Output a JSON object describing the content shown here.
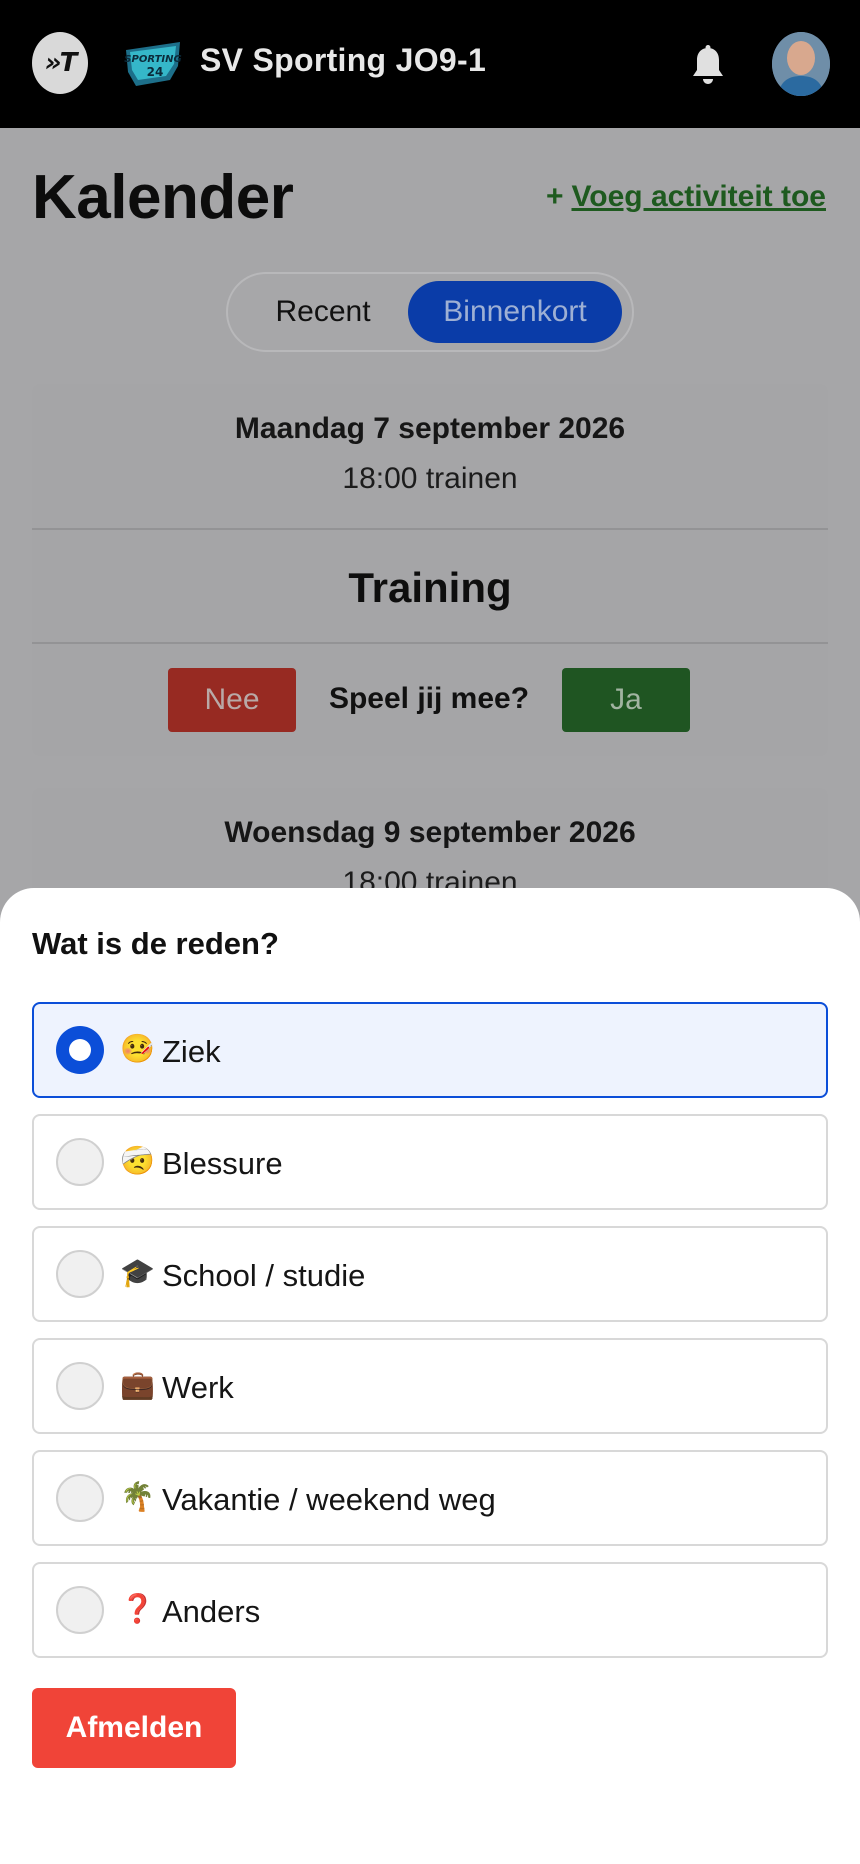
{
  "header": {
    "app_logo_text": "»T",
    "team_logo_text": "SPORTING 24",
    "team_name": "SV Sporting JO9-1",
    "icons": {
      "bell": "bell-icon",
      "avatar": "user-avatar"
    }
  },
  "page": {
    "title": "Kalender",
    "add_plus": "+",
    "add_label": "Voeg activiteit toe"
  },
  "tabs": {
    "recent": "Recent",
    "upcoming": "Binnenkort",
    "selected": "upcoming"
  },
  "events": [
    {
      "date": "Maandag 7 september 2026",
      "time": "18:00 trainen",
      "type": "Training",
      "no": "Nee",
      "question": "Speel jij mee?",
      "yes": "Ja"
    },
    {
      "date": "Woensdag 9 september 2026",
      "time": "18:00 trainen"
    }
  ],
  "sheet": {
    "title": "Wat is de reden?",
    "options": [
      {
        "emoji": "🤒",
        "label": "Ziek",
        "selected": true
      },
      {
        "emoji": "🤕",
        "label": "Blessure",
        "selected": false
      },
      {
        "emoji": "🎓",
        "label": "School / studie",
        "selected": false
      },
      {
        "emoji": "💼",
        "label": "Werk",
        "selected": false
      },
      {
        "emoji": "🌴",
        "label": "Vakantie / weekend weg",
        "selected": false
      },
      {
        "emoji": "❓",
        "label": "Anders",
        "selected": false
      }
    ],
    "submit": "Afmelden"
  },
  "colors": {
    "topbar": "#000000",
    "primary": "#0b4ed8",
    "danger": "#f04438",
    "success": "#2e7d32",
    "link": "#2e7d32"
  }
}
